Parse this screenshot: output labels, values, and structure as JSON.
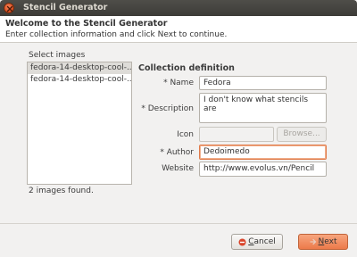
{
  "window": {
    "title": "Stencil Generator"
  },
  "header": {
    "title": "Welcome to the Stencil Generator",
    "subtitle": "Enter collection information and click Next to continue."
  },
  "images": {
    "label": "Select images",
    "items": [
      "fedora-14-desktop-cool-...",
      "fedora-14-desktop-cool-..."
    ],
    "footer": "2 images found."
  },
  "collection": {
    "section_title": "Collection definition",
    "name_label": "* Name",
    "name_value": "Fedora",
    "description_label": "* Description",
    "description_value": "I don't know what stencils are",
    "icon_label": "Icon",
    "icon_value": "",
    "browse_label": "Browse...",
    "author_label": "* Author",
    "author_value": "Dedoimedo",
    "website_label": "Website",
    "website_value": "http://www.evolus.vn/Pencil"
  },
  "buttons": {
    "cancel_mnemonic": "C",
    "cancel_rest": "ancel",
    "next_mnemonic": "N",
    "next_rest": "ext"
  },
  "colors": {
    "titlebar": "#3d3c38",
    "accent": "#ec7a4a",
    "focus_border": "#e07a49"
  }
}
